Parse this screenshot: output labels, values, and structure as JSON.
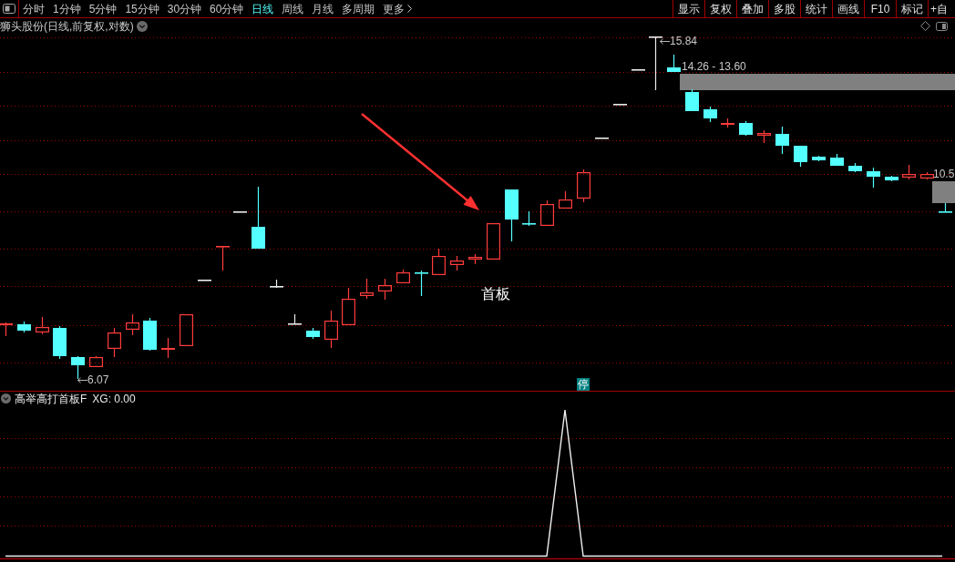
{
  "toolbar": {
    "tabs": [
      {
        "label": "分时",
        "selected": false
      },
      {
        "label": "1分钟",
        "selected": false
      },
      {
        "label": "5分钟",
        "selected": false
      },
      {
        "label": "15分钟",
        "selected": false
      },
      {
        "label": "30分钟",
        "selected": false
      },
      {
        "label": "60分钟",
        "selected": false
      },
      {
        "label": "日线",
        "selected": true
      },
      {
        "label": "周线",
        "selected": false
      },
      {
        "label": "月线",
        "selected": false
      },
      {
        "label": "多周期",
        "selected": false
      }
    ],
    "more": "更多",
    "buttons": [
      "显示",
      "复权",
      "叠加",
      "多股",
      "统计",
      "画线",
      "F10",
      "标记",
      "+自"
    ]
  },
  "chart": {
    "title": "狮头股份(日线,前复权,对数)",
    "price_labels": [
      {
        "kind": "high",
        "text": "15.84"
      },
      {
        "kind": "range",
        "text": "14.26 - 13.60"
      },
      {
        "kind": "last",
        "text": "10.5"
      },
      {
        "kind": "low",
        "text": "6.07"
      }
    ],
    "annotation": "首板",
    "badge": "停"
  },
  "indicator": {
    "name": "高举高打首板F",
    "reading": "XG: 0.00"
  }
}
